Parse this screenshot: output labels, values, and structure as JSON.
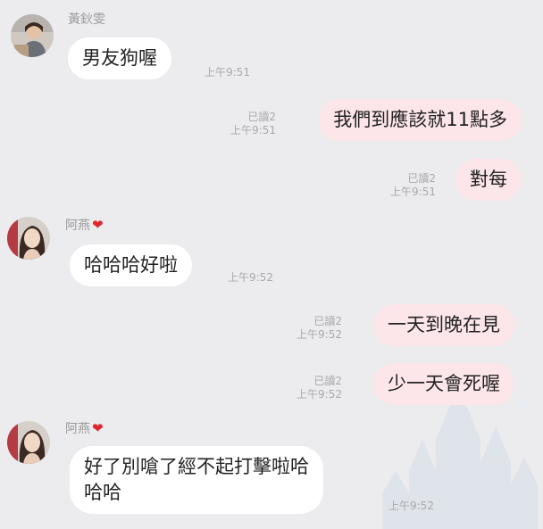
{
  "chat": {
    "messages": [
      {
        "sender": "黃鈥雯",
        "text": "男友狗喔",
        "time": "上午9:51"
      },
      {
        "text": "我們到應該就11點多",
        "read": "已讀2",
        "time": "上午9:51"
      },
      {
        "text": "對每",
        "read": "已讀2",
        "time": "上午9:51"
      },
      {
        "sender": "阿燕",
        "text": "哈哈哈好啦",
        "time": "上午9:52"
      },
      {
        "text": "一天到晚在見",
        "read": "已讀2",
        "time": "上午9:52"
      },
      {
        "text": "少一天會死喔",
        "read": "已讀2",
        "time": "上午9:52"
      },
      {
        "sender": "阿燕",
        "text_line1": "好了別嗆了經不起打擊啦哈",
        "text_line2": "哈哈",
        "time": "上午9:52"
      }
    ]
  },
  "icons": {
    "heart": "❤",
    "heart_icon_name": "heart-icon",
    "avatar_icon_name": "avatar"
  },
  "colors": {
    "background": "#ecebee",
    "incoming_bubble": "#ffffff",
    "outgoing_bubble": "#fce6ea",
    "meta_text": "#a9a9a9",
    "heart": "#e0282e"
  }
}
